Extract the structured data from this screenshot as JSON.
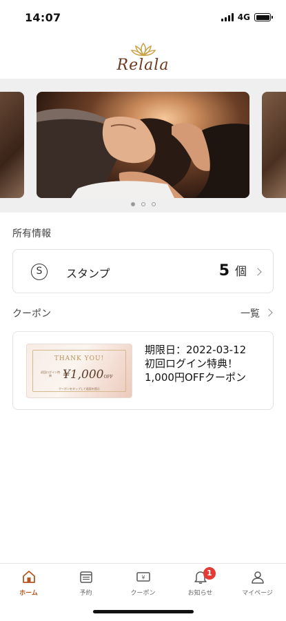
{
  "status_bar": {
    "time": "14:07",
    "network": "4G"
  },
  "header": {
    "logo_text": "Relala"
  },
  "carousel": {
    "slide_count": 3,
    "active_index": 0
  },
  "owned_info": {
    "title": "所有情報",
    "stamp": {
      "label": "スタンプ",
      "count": "5",
      "unit": "個"
    }
  },
  "coupons": {
    "title": "クーポン",
    "list_link": "一覧",
    "items": [
      {
        "expiry": "期限日：2022-03-12",
        "line1": "初回ログイン特典！",
        "line2": "1,000円OFFクーポン",
        "thumb": {
          "thank": "THANK YOU!",
          "amount": "¥1,000",
          "amount_suffix": "OFF",
          "badge": "初回ログイン特典",
          "note": "クーポンをタップして画面を提示"
        }
      }
    ]
  },
  "bottom_nav": {
    "items": [
      {
        "label": "ホーム",
        "icon": "home-icon",
        "active": true
      },
      {
        "label": "予約",
        "icon": "calendar-icon",
        "active": false
      },
      {
        "label": "クーポン",
        "icon": "coupon-icon",
        "active": false
      },
      {
        "label": "お知らせ",
        "icon": "bell-icon",
        "active": false,
        "badge": "1"
      },
      {
        "label": "マイページ",
        "icon": "user-icon",
        "active": false
      }
    ]
  },
  "colors": {
    "accent": "#b5541f",
    "badge": "#e53935",
    "carousel_bg": "#efefef"
  }
}
